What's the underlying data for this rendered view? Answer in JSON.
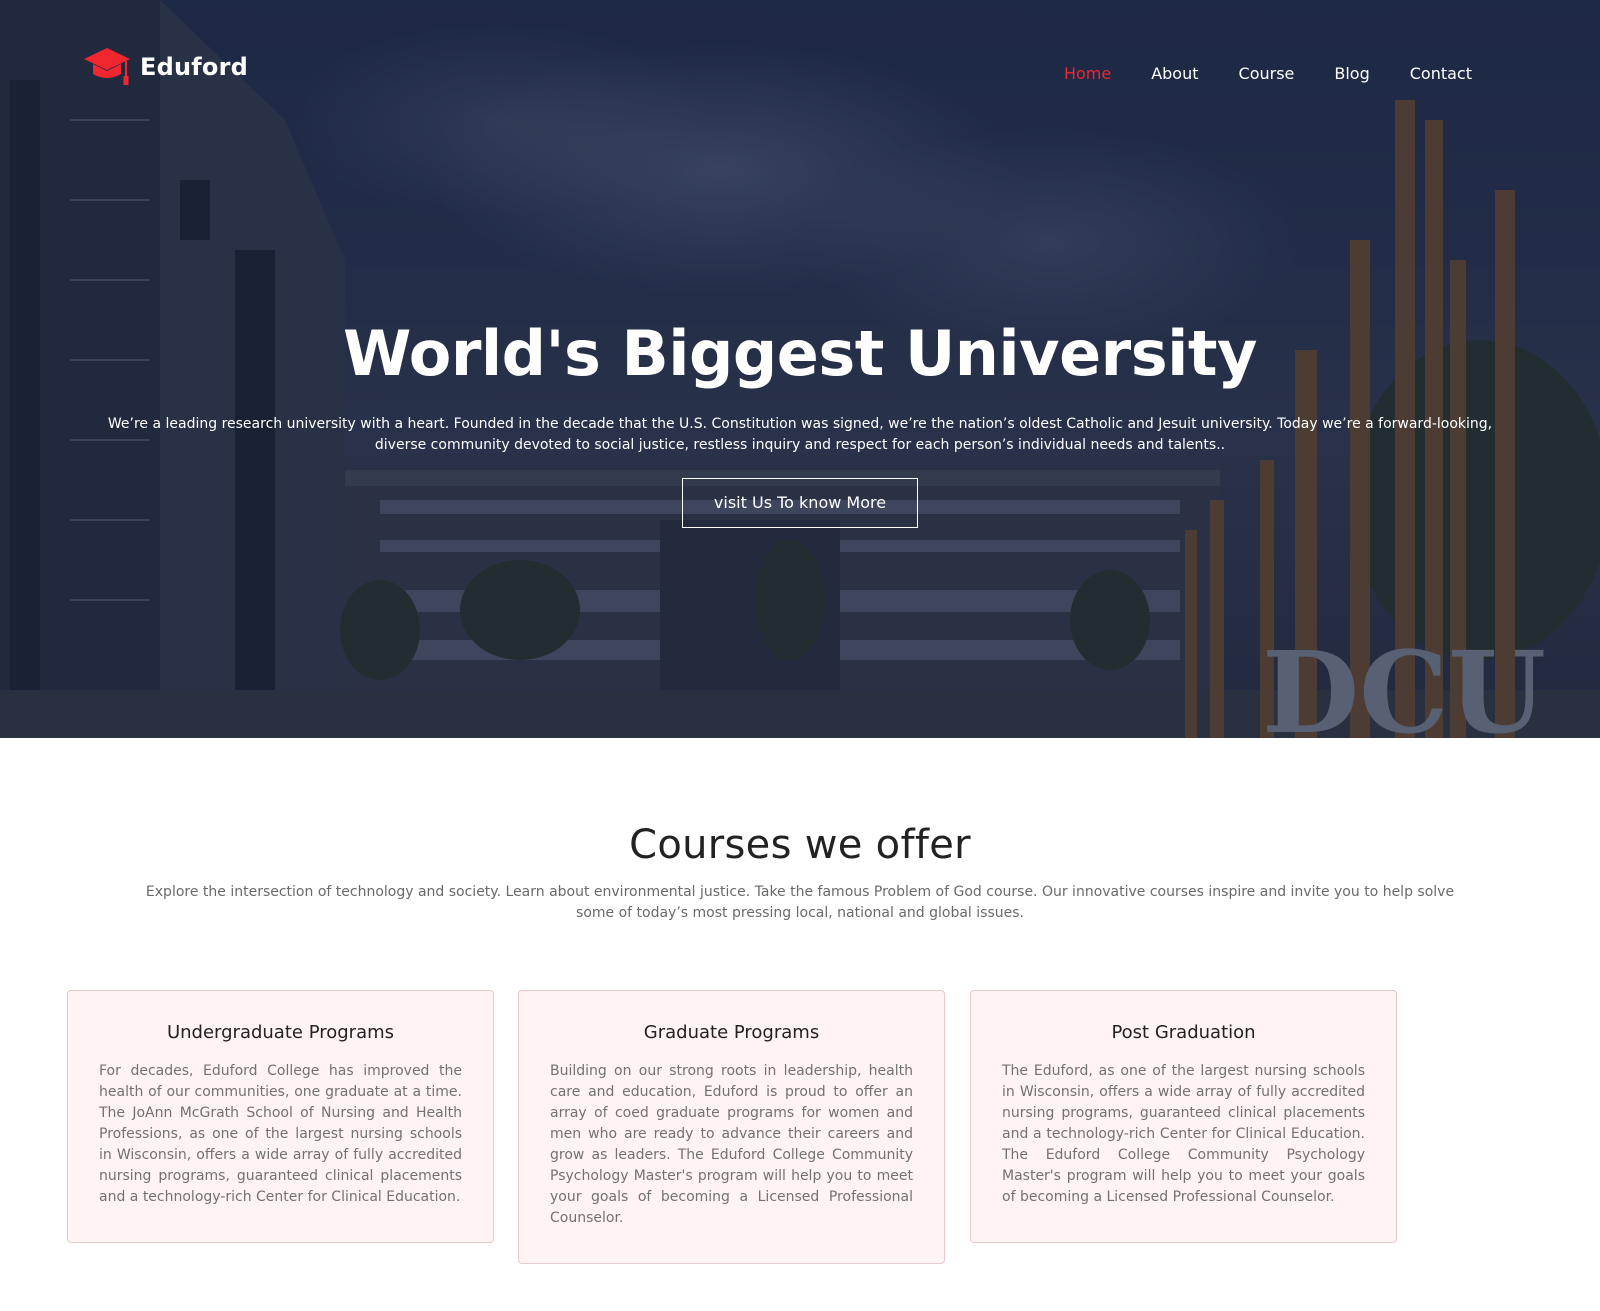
{
  "brand": {
    "name": "Eduford",
    "icon": "graduation-cap-icon",
    "icon_color": "#f2262f"
  },
  "nav": {
    "items": [
      {
        "label": "Home",
        "active": true
      },
      {
        "label": "About",
        "active": false
      },
      {
        "label": "Course",
        "active": false
      },
      {
        "label": "Blog",
        "active": false
      },
      {
        "label": "Contact",
        "active": false
      }
    ],
    "active_color": "#f2262f"
  },
  "hero": {
    "title": "World's Biggest University",
    "text": "We’re a leading research university with a heart. Founded in the decade that the U.S. Constitution was signed, we’re the nation’s oldest Catholic and Jesuit university. Today we’re a forward-looking, diverse community devoted to social justice, restless inquiry and respect for each person’s individual needs and talents..",
    "button_label": "visit Us To know More",
    "background_sign": "DCU"
  },
  "courses": {
    "title": "Courses we offer",
    "subtitle": "Explore the intersection of technology and society. Learn about environmental justice. Take the famous Problem of God course. Our innovative courses inspire and invite you to help solve some of today’s most pressing local, national and global issues.",
    "cards": [
      {
        "title": "Undergraduate Programs",
        "text": "For decades, Eduford College has improved the health of our communities, one graduate at a time. The JoAnn McGrath School of Nursing and Health Professions, as one of the largest nursing schools in Wisconsin, offers a wide array of fully accredited nursing programs, guaranteed clinical placements and a technology-rich Center for Clinical Education."
      },
      {
        "title": "Graduate Programs",
        "text": "Building on our strong roots in leadership, health care and education, Eduford is proud to offer an array of coed graduate programs for women and men who are ready to advance their careers and grow as leaders. The Eduford College Community Psychology Master's program will help you to meet your goals of becoming a Licensed Professional Counselor."
      },
      {
        "title": "Post Graduation",
        "text": "The Eduford, as one of the largest nursing schools in Wisconsin, offers a wide array of fully accredited nursing programs, guaranteed clinical placements and a technology-rich Center for Clinical Education. The Eduford College Community Psychology Master's program will help you to meet your goals of becoming a Licensed Professional Counselor."
      }
    ]
  }
}
